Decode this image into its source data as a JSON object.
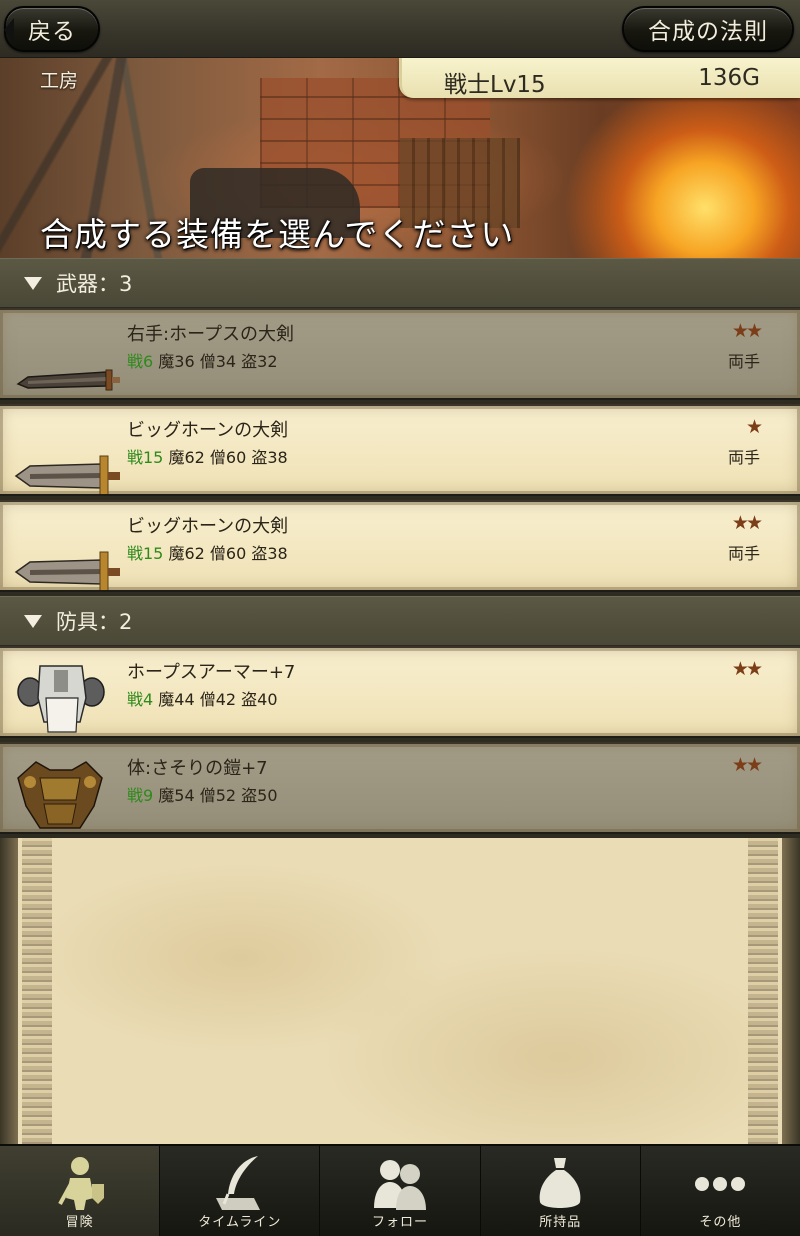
{
  "header": {
    "back_label": "戻る",
    "rules_label": "合成の法則"
  },
  "banner": {
    "location": "工房",
    "player_class": "戦士Lv15",
    "gold": "136G",
    "prompt": "合成する装備を選んでください"
  },
  "sections": [
    {
      "label": "武器：3",
      "items": [
        {
          "name": "右手:ホープスの大剣",
          "war": "戦6",
          "stats": "魔36 僧34 盗32",
          "stars": "★★",
          "hands": "両手",
          "icon": "greatsword-icon",
          "state": "equipped"
        },
        {
          "name": "ビッグホーンの大剣",
          "war": "戦15",
          "stats": "魔62 僧60 盗38",
          "stars": "★",
          "hands": "両手",
          "icon": "broadsword-icon",
          "state": "available"
        },
        {
          "name": "ビッグホーンの大剣",
          "war": "戦15",
          "stats": "魔62 僧60 盗38",
          "stars": "★★",
          "hands": "両手",
          "icon": "broadsword-icon",
          "state": "available"
        }
      ]
    },
    {
      "label": "防具：2",
      "items": [
        {
          "name": "ホープスアーマー+7",
          "war": "戦4",
          "stats": "魔44 僧42 盗40",
          "stars": "★★",
          "hands": "",
          "icon": "plate-armor-icon",
          "state": "available"
        },
        {
          "name": "体:さそりの鎧+7",
          "war": "戦9",
          "stats": "魔54 僧52 盗50",
          "stars": "★★",
          "hands": "",
          "icon": "scorpion-armor-icon",
          "state": "equipped"
        }
      ]
    }
  ],
  "tabbar": {
    "tabs": [
      {
        "label": "冒険",
        "icon": "adventurer-icon",
        "selected": true
      },
      {
        "label": "タイムライン",
        "icon": "quill-icon",
        "selected": false
      },
      {
        "label": "フォロー",
        "icon": "people-icon",
        "selected": false
      },
      {
        "label": "所持品",
        "icon": "bag-icon",
        "selected": false
      },
      {
        "label": "その他",
        "icon": "more-icon",
        "selected": false
      }
    ]
  },
  "colors": {
    "stat_war": "#2f8a1c",
    "star": "#7c3d19",
    "active_row": "#f8efcf",
    "inactive_row": "#a39d88"
  }
}
